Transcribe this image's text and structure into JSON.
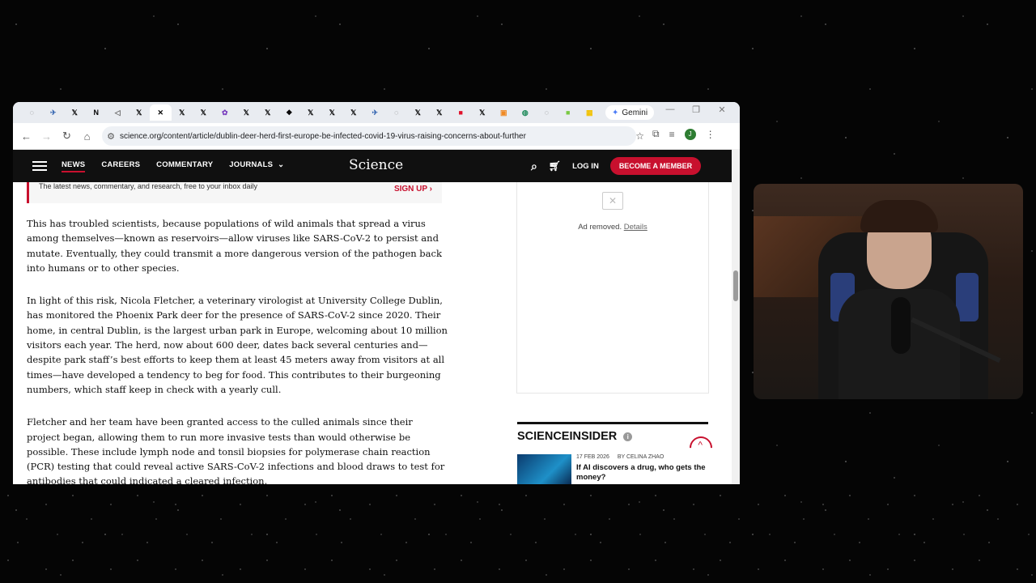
{
  "browser": {
    "tabs": [
      {
        "icon": "globe-icon",
        "glyph": "◌",
        "color": "#666"
      },
      {
        "icon": "bird-icon",
        "glyph": "✈",
        "color": "#3b6ab3"
      },
      {
        "icon": "x-icon",
        "glyph": "𝕏",
        "color": "#000"
      },
      {
        "icon": "notion-icon",
        "glyph": "N",
        "color": "#000"
      },
      {
        "icon": "speaker-icon",
        "glyph": "◁",
        "color": "#666"
      },
      {
        "icon": "x-icon",
        "glyph": "𝕏",
        "color": "#000"
      },
      {
        "icon": "close-icon",
        "glyph": "✕",
        "color": "#000"
      },
      {
        "icon": "x-icon",
        "glyph": "𝕏",
        "color": "#000"
      },
      {
        "icon": "x-icon",
        "glyph": "𝕏",
        "color": "#000"
      },
      {
        "icon": "colorful-icon",
        "glyph": "✿",
        "color": "#7a3fbf"
      },
      {
        "icon": "x-icon",
        "glyph": "𝕏",
        "color": "#000"
      },
      {
        "icon": "x-icon",
        "glyph": "𝕏",
        "color": "#000"
      },
      {
        "icon": "paw-icon",
        "glyph": "❖",
        "color": "#000"
      },
      {
        "icon": "x-icon",
        "glyph": "𝕏",
        "color": "#000"
      },
      {
        "icon": "x-icon",
        "glyph": "𝕏",
        "color": "#000"
      },
      {
        "icon": "x-icon",
        "glyph": "𝕏",
        "color": "#000"
      },
      {
        "icon": "bird-icon",
        "glyph": "✈",
        "color": "#3b6ab3"
      },
      {
        "icon": "globe-icon",
        "glyph": "◌",
        "color": "#666"
      },
      {
        "icon": "x-icon",
        "glyph": "𝕏",
        "color": "#000"
      },
      {
        "icon": "x-icon",
        "glyph": "𝕏",
        "color": "#000"
      },
      {
        "icon": "red-square-icon",
        "glyph": "■",
        "color": "#e0102a"
      },
      {
        "icon": "x-icon",
        "glyph": "𝕏",
        "color": "#000"
      },
      {
        "icon": "orange-square-icon",
        "glyph": "▣",
        "color": "#f08a24"
      },
      {
        "icon": "green-circle-icon",
        "glyph": "◍",
        "color": "#1d8a5a"
      },
      {
        "icon": "globe-icon",
        "glyph": "◌",
        "color": "#666"
      },
      {
        "icon": "green-square-icon",
        "glyph": "■",
        "color": "#7ac943"
      },
      {
        "icon": "yellow-square-icon",
        "glyph": "▦",
        "color": "#f2c100"
      },
      {
        "icon": "copilot-icon",
        "glyph": "Co",
        "color": "#555"
      }
    ],
    "gemini_label": "Gemini",
    "url": "science.org/content/article/dublin-deer-herd-first-europe-be-infected-covid-19-virus-raising-concerns-about-further",
    "avatar_letter": "J"
  },
  "site": {
    "nav": [
      "NEWS",
      "CAREERS",
      "COMMENTARY",
      "JOURNALS"
    ],
    "logo": "Science",
    "login": "LOG IN",
    "member": "BECOME A MEMBER",
    "accent": "#c8102e"
  },
  "signup": {
    "text": "The latest news, commentary, and research, free to your inbox daily",
    "button": "SIGN UP"
  },
  "article": {
    "paragraphs": [
      "This has troubled scientists, because populations of wild animals that spread a virus among themselves—known as reservoirs—allow viruses like SARS-CoV-2 to persist and mutate. Eventually, they could transmit a more dangerous version of the pathogen back into humans or to other species.",
      "In light of this risk, Nicola Fletcher, a veterinary virologist at University College Dublin, has monitored the Phoenix Park deer for the presence of SARS-CoV-2 since 2020. Their home, in central Dublin, is the largest urban park in Europe, welcoming about 10 million visitors each year. The herd, now about 600 deer, dates back several centuries and—despite park staff’s best efforts to keep them at least 45 meters away from visitors at all times—have developed a tendency to beg for food. This contributes to their burgeoning numbers, which staff keep in check with a yearly cull.",
      "Fletcher and her team have been granted access to the culled animals since their project began, allowing them to run more invasive tests than would otherwise be possible. These include lymph node and tonsil biopsies for polymerase chain reaction (PCR) testing that could reveal active SARS-CoV-2 infections and blood draws to test for antibodies that could indicated a cleared infection."
    ]
  },
  "ad": {
    "text": "Ad removed.",
    "details": "Details"
  },
  "insider": {
    "title": "SCIENCEINSIDER",
    "date": "17 FEB 2026",
    "byline": "BY CELINA ZHAO",
    "headline": "If AI discovers a drug, who gets the money?"
  }
}
